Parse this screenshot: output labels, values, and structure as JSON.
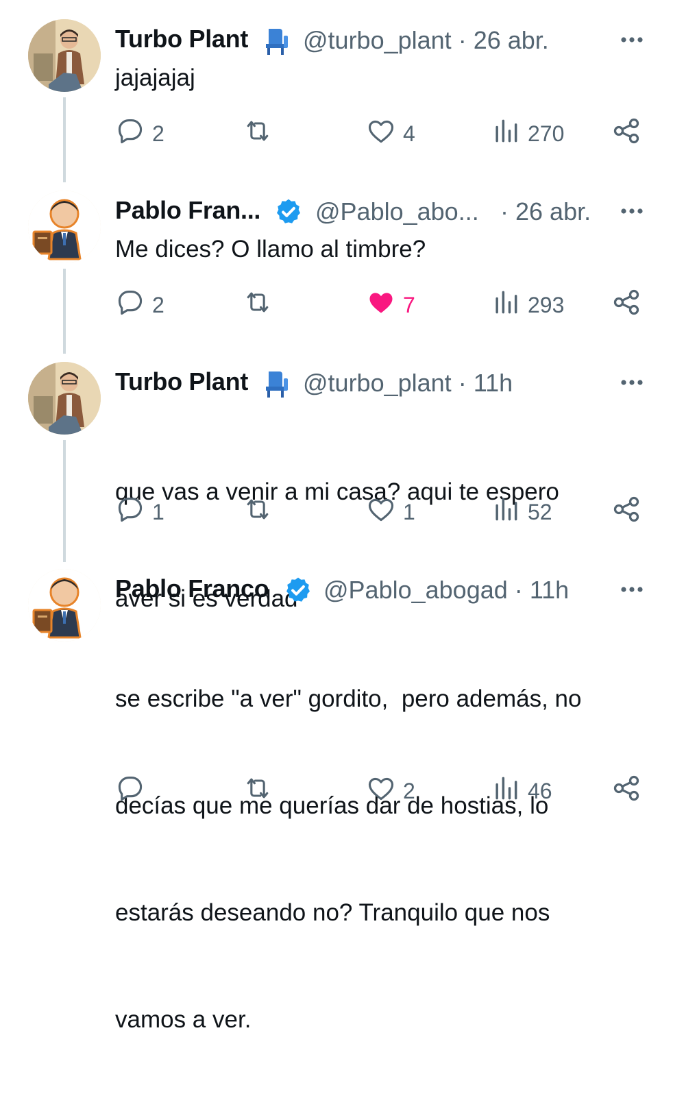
{
  "tweets": [
    {
      "name": "Turbo Plant",
      "name_icon": "chair-emoji-icon",
      "verified": false,
      "handle": "@turbo_plant",
      "separator": "·",
      "time": "26 abr.",
      "text": "jajajajaj",
      "replies": "2",
      "likes": "4",
      "liked": false,
      "views": "270"
    },
    {
      "name": "Pablo Fran...",
      "verified": true,
      "handle": "@Pablo_abo...",
      "separator": "·",
      "time": "26 abr.",
      "text": "Me dices? O llamo al timbre?",
      "replies": "2",
      "likes": "7",
      "liked": true,
      "views": "293"
    },
    {
      "name": "Turbo Plant",
      "name_icon": "chair-emoji-icon",
      "verified": false,
      "handle": "@turbo_plant",
      "separator": "·",
      "time": "11h",
      "text_lines": [
        "que vas a venir a mi casa? aqui te espero",
        "aver si es verdad"
      ],
      "replies": "1",
      "likes": "1",
      "liked": false,
      "views": "52"
    },
    {
      "name": "Pablo Franco",
      "verified": true,
      "handle": "@Pablo_abogad",
      "separator": "·",
      "time": "11h",
      "text_lines": [
        "se escribe \"a ver\" gordito,  pero además, no",
        "decías que me querías dar de hostias, lo",
        "estarás deseando no? Tranquilo que nos",
        "vamos a ver."
      ],
      "replies": "",
      "likes": "2",
      "liked": false,
      "views": "46"
    }
  ],
  "colors": {
    "text": "#0f1419",
    "secondary": "#536471",
    "verified": "#1d9bf0",
    "like": "#f91880",
    "thread_line": "#cfd9de"
  }
}
